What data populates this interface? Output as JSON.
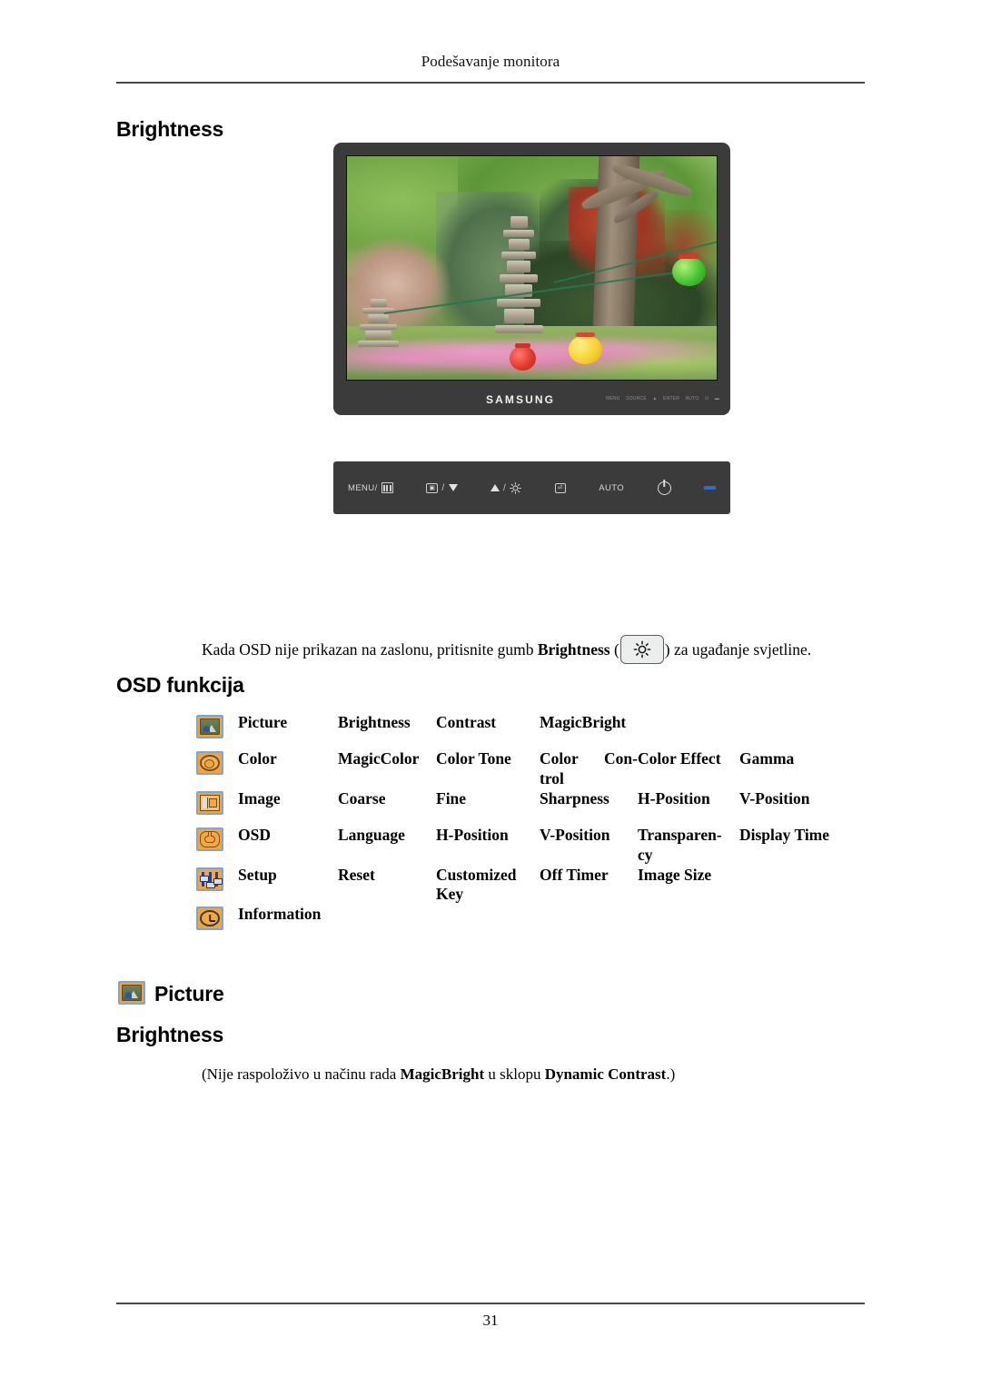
{
  "header": {
    "running_title": "Podešavanje monitora"
  },
  "headings": {
    "brightness_top": "Brightness",
    "osd_funkcija": "OSD funkcija",
    "picture": "Picture",
    "brightness_bottom": "Brightness"
  },
  "monitor": {
    "brand": "SAMSUNG",
    "controls": [
      {
        "name": "menu-button",
        "label": "MENU/",
        "glyph": "menu-bars-icon"
      },
      {
        "name": "source-down-button",
        "label": "",
        "glyph": "source-icon",
        "separator": "/",
        "glyph2": "triangle-down-icon"
      },
      {
        "name": "up-brightness-button",
        "label": "",
        "glyph": "triangle-up-icon",
        "separator": "/",
        "glyph2": "sun-icon"
      },
      {
        "name": "enter-button",
        "label": "",
        "glyph": "enter-icon"
      },
      {
        "name": "auto-button",
        "label": "AUTO",
        "glyph": ""
      },
      {
        "name": "power-button",
        "label": "",
        "glyph": "power-icon"
      },
      {
        "name": "power-led",
        "label": "",
        "glyph": "led-indicator"
      }
    ],
    "bezel_mini_labels": [
      "MENU",
      "SOURCE",
      "▲",
      "ENTER",
      "AUTO",
      "⏻",
      "▬"
    ]
  },
  "paragraphs": {
    "brightness_instruction": {
      "before_bold": "Kada OSD nije prikazan na zaslonu, pritisnite gumb ",
      "bold": "Brightness",
      "after_bold_open": " (",
      "after_bold_close": ") za ugađanje svjetline."
    },
    "bottom_note": {
      "part1": "(Nije raspoloživo u načinu rada ",
      "bold1": "MagicBright",
      "part2": " u sklopu ",
      "bold2": "Dynamic Contrast",
      "part3": ".)"
    }
  },
  "osd_table": {
    "rows": [
      {
        "icon": "picture-icon",
        "label": "Picture",
        "items": [
          "Brightness",
          "Contrast",
          "MagicBright",
          "",
          ""
        ]
      },
      {
        "icon": "color-icon",
        "label": "Color",
        "items": [
          "MagicColor",
          "Color Tone",
          "Color Con-trol",
          "Color Effect",
          "Gamma"
        ],
        "split_index": 2,
        "split_left": "Color",
        "split_right": "Con-",
        "split_second_line": "trol"
      },
      {
        "icon": "image-icon",
        "label": "Image",
        "items": [
          "Coarse",
          "Fine",
          "Sharpness",
          "H-Position",
          "V-Position"
        ]
      },
      {
        "icon": "osd-icon",
        "label": "OSD",
        "items": [
          "Language",
          "H-Position",
          "V-Position",
          "Transparen-cy",
          "Display Time"
        ],
        "wrap_index": 3,
        "wrap_first": "Transparen-",
        "wrap_second": "cy"
      },
      {
        "icon": "setup-icon",
        "label": "Setup",
        "items": [
          "Reset",
          "Customized Key",
          "Off Timer",
          "Image Size",
          ""
        ],
        "wrap_index": 1,
        "wrap_first": "Customized",
        "wrap_second": "Key"
      },
      {
        "icon": "information-icon",
        "label": "Information",
        "items": [
          "",
          "",
          "",
          "",
          ""
        ]
      }
    ]
  },
  "footer": {
    "page_number": "31"
  },
  "colors": {
    "icon_fill": "#f0a63c",
    "icon_border": "#7ba7d7",
    "bezel": "#3b3b3b",
    "led": "#2a6fd6",
    "rule": "#4a4a4a"
  }
}
